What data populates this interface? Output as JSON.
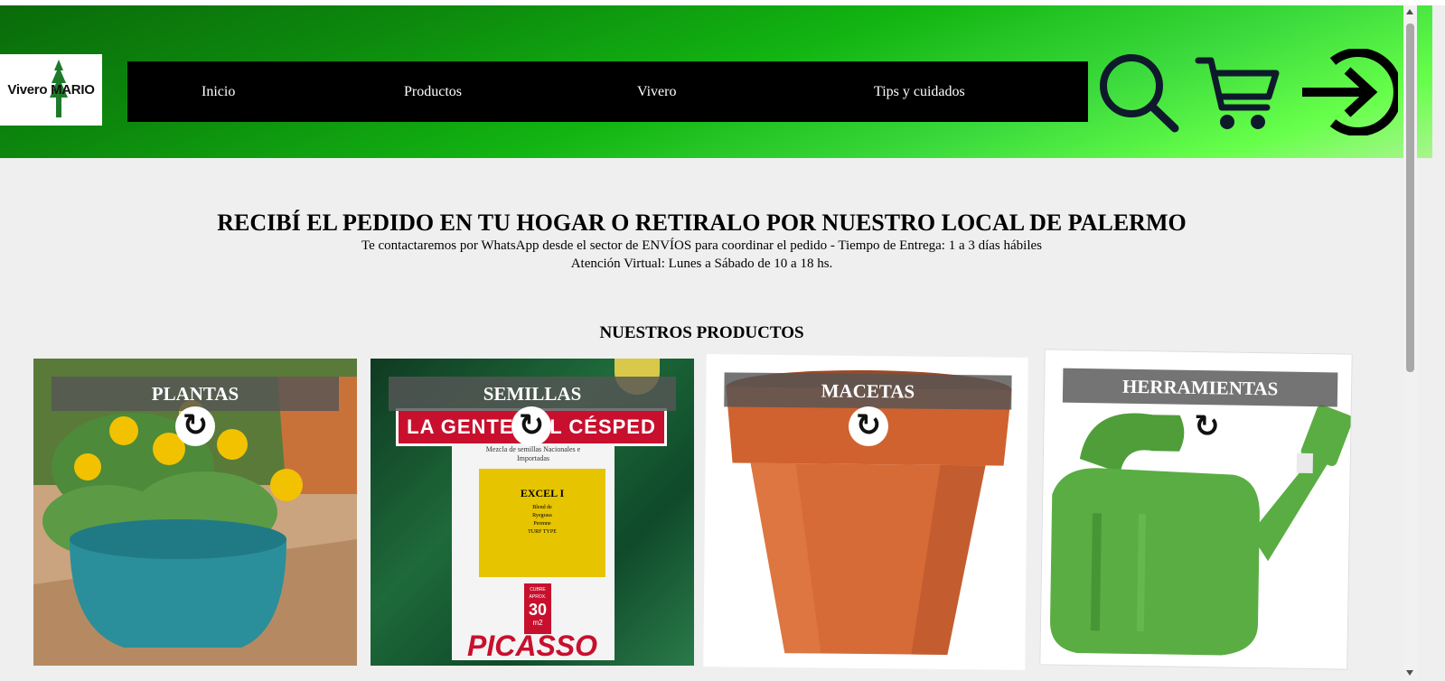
{
  "header": {
    "logo_text": "Vivero MARIO",
    "gradient_colors": [
      "#0a6b0a",
      "#12b512",
      "#66ff4a"
    ],
    "nav": [
      {
        "label": "Inicio"
      },
      {
        "label": "Productos"
      },
      {
        "label": "Vivero"
      },
      {
        "label": "Tips y cuidados"
      }
    ],
    "icons": [
      "search-icon",
      "cart-icon",
      "login-arrow-icon"
    ]
  },
  "banner": {
    "title": "RECIBÍ EL PEDIDO EN TU HOGAR O RETIRALO POR NUESTRO LOCAL DE PALERMO",
    "line1": "Te contactaremos por WhatsApp desde el sector de ENVÍOS para coordinar el pedido - Tiempo de Entrega: 1 a 3 días hábiles",
    "line2": "Atención Virtual: Lunes a Sábado de 10 a 18 hs."
  },
  "products": {
    "title": "NUESTROS PRODUCTOS",
    "flip_glyph": "↻",
    "cards": [
      {
        "label": "PLANTAS",
        "image": "potted-yellow-flowers"
      },
      {
        "label": "SEMILLAS",
        "image": "seed-bag",
        "bag_title": "LA GENTE DEL CÉSPED",
        "bag_sub": "Mezcla de semillas Nacionales e Importadas",
        "bag_product": "EXCEL I",
        "bag_lines": [
          "Blend de",
          "Ryegrass",
          "Perenne",
          "TURF TYPE"
        ],
        "bag_badge_top": "CUBRE APROX.",
        "bag_badge_value": "30",
        "bag_badge_unit": "m2",
        "bag_brand": "PICASSO"
      },
      {
        "label": "MACETAS",
        "image": "terracotta-pot"
      },
      {
        "label": "HERRAMIENTAS",
        "image": "green-watering-can"
      }
    ]
  }
}
